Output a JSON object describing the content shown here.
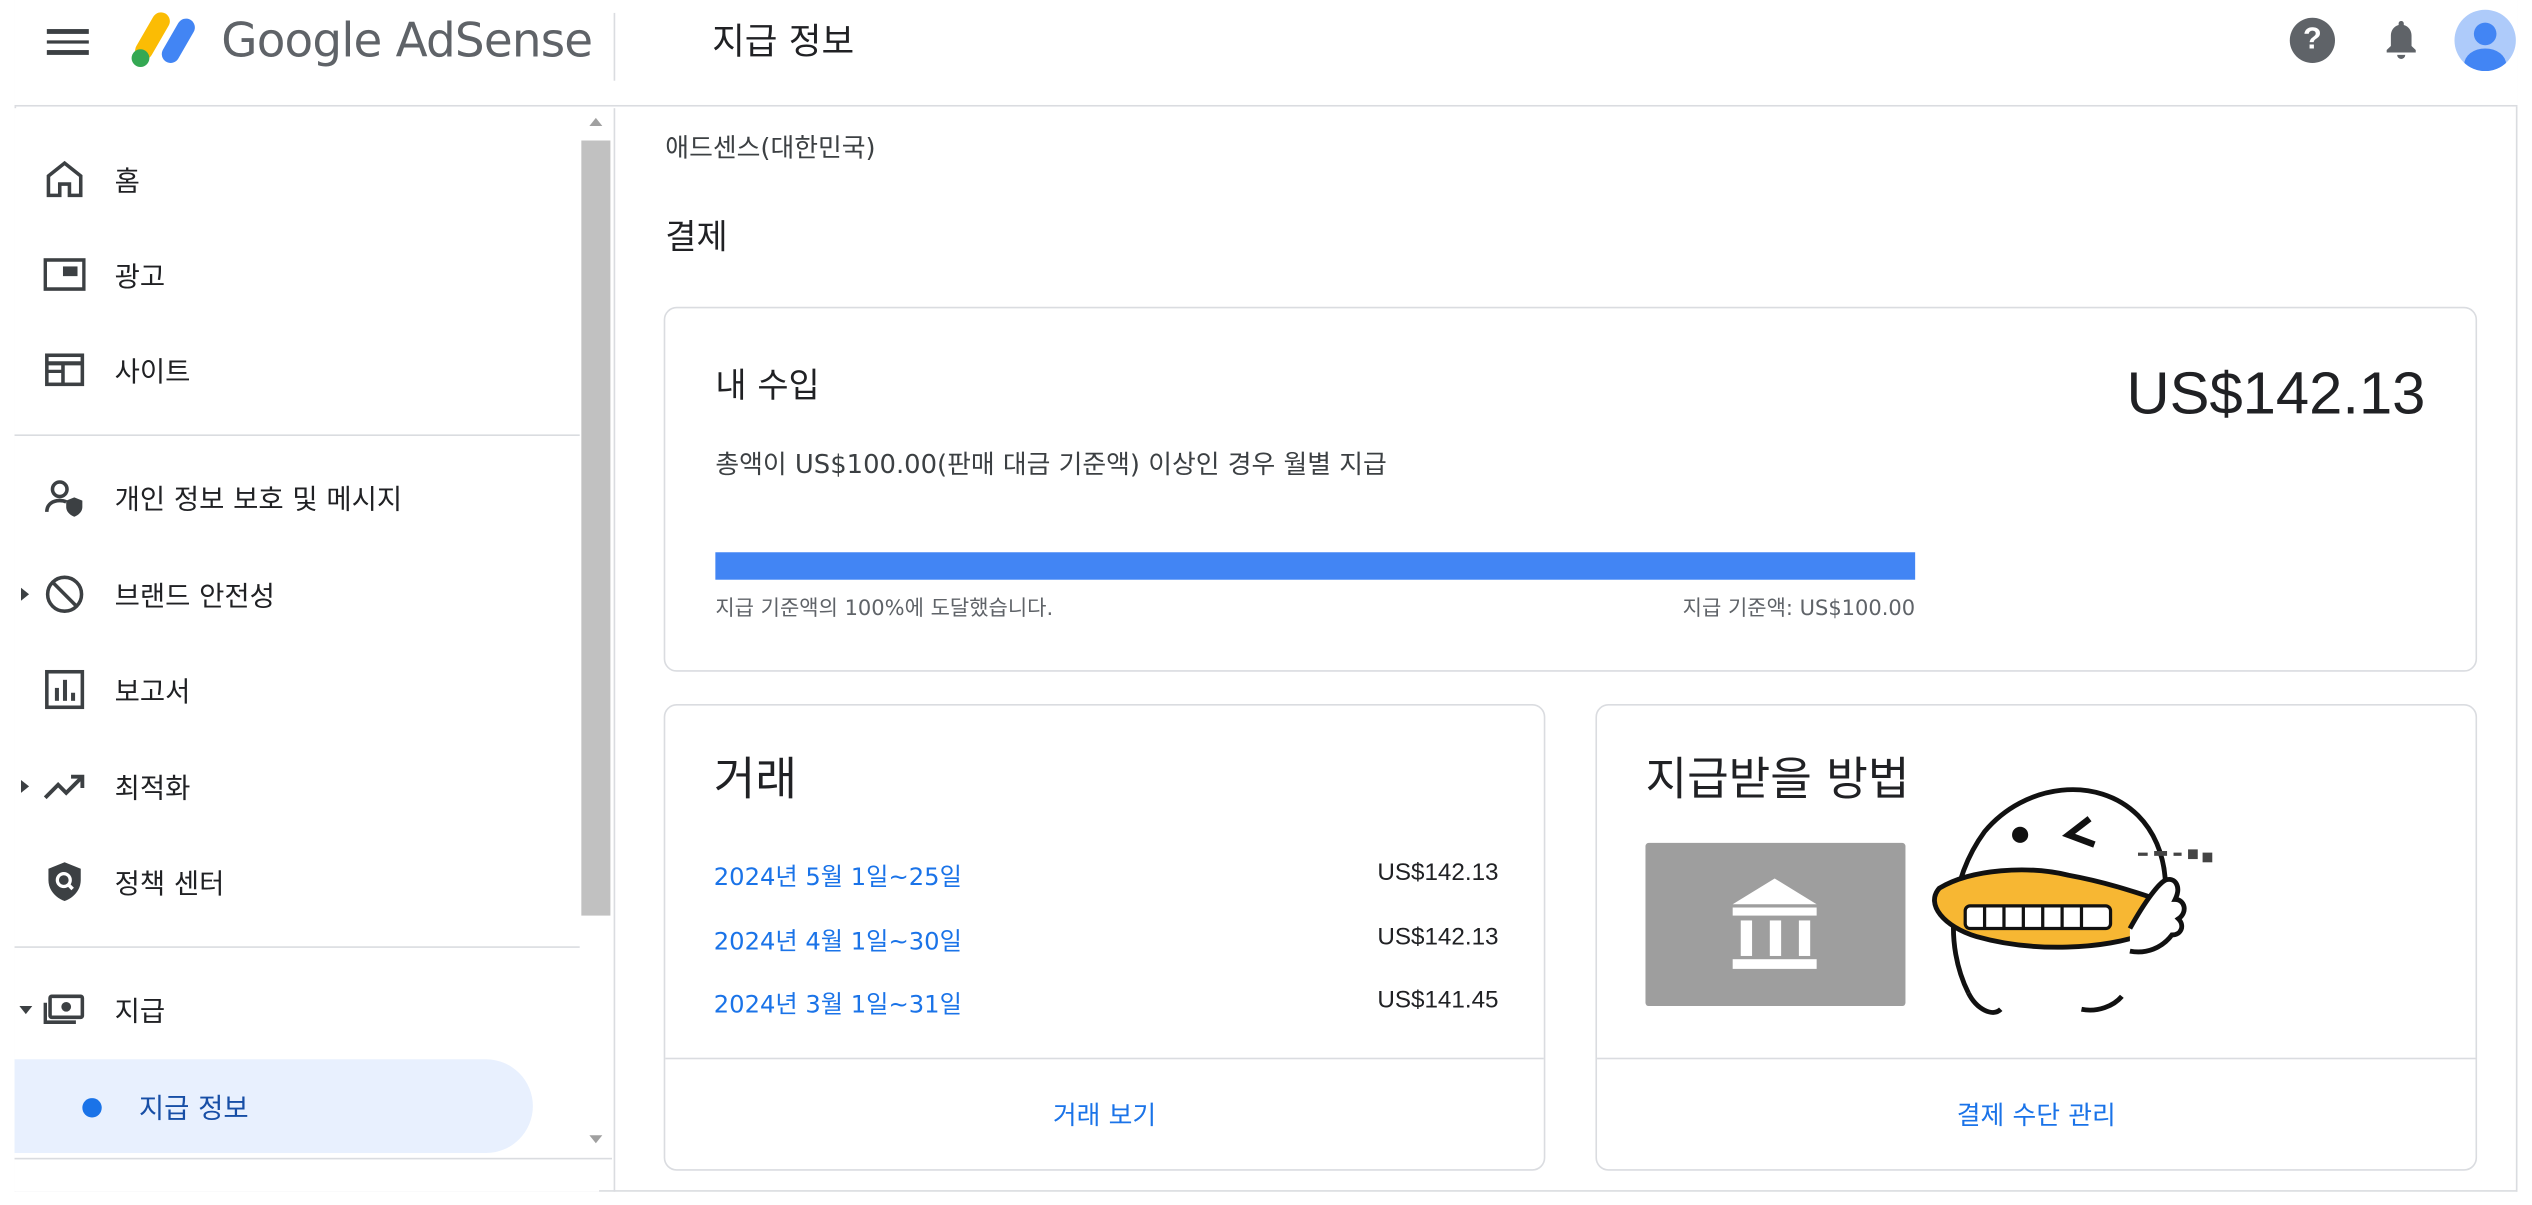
{
  "header": {
    "brand": "Google AdSense",
    "page_title": "지급 정보"
  },
  "sidebar": {
    "items": [
      {
        "label": "홈",
        "icon": "home-icon"
      },
      {
        "label": "광고",
        "icon": "ads-icon"
      },
      {
        "label": "사이트",
        "icon": "sites-icon"
      },
      {
        "label": "개인 정보 보호 및 메시지",
        "icon": "privacy-icon"
      },
      {
        "label": "브랜드 안전성",
        "icon": "block-icon"
      },
      {
        "label": "보고서",
        "icon": "reports-icon"
      },
      {
        "label": "최적화",
        "icon": "trending-icon"
      },
      {
        "label": "정책 센터",
        "icon": "policy-icon"
      },
      {
        "label": "지급",
        "icon": "payments-icon"
      }
    ],
    "active_sub": {
      "label": "지급 정보"
    }
  },
  "main": {
    "account": "애드센스(대한민국)",
    "section_title": "결제",
    "earnings": {
      "title": "내 수입",
      "subtitle": "총액이 US$100.00(판매 대금 기준액) 이상인 경우 월별 지급",
      "amount": "US$142.13",
      "progress_percent": 100,
      "progress_left": "지급 기준액의 100%에 도달했습니다.",
      "progress_right": "지급 기준액: US$100.00"
    },
    "transactions": {
      "title": "거래",
      "rows": [
        {
          "period": "2024년 5월 1일~25일",
          "amount": "US$142.13"
        },
        {
          "period": "2024년 4월 1일~30일",
          "amount": "US$142.13"
        },
        {
          "period": "2024년 3월 1일~31일",
          "amount": "US$141.45"
        }
      ],
      "action": "거래 보기"
    },
    "payment_method": {
      "title": "지급받을 방법",
      "icon": "bank-icon",
      "action": "결제 수단 관리"
    }
  },
  "colors": {
    "accent": "#1a73e8",
    "progress": "#4285f4",
    "active_bg": "#e8f0fe"
  }
}
